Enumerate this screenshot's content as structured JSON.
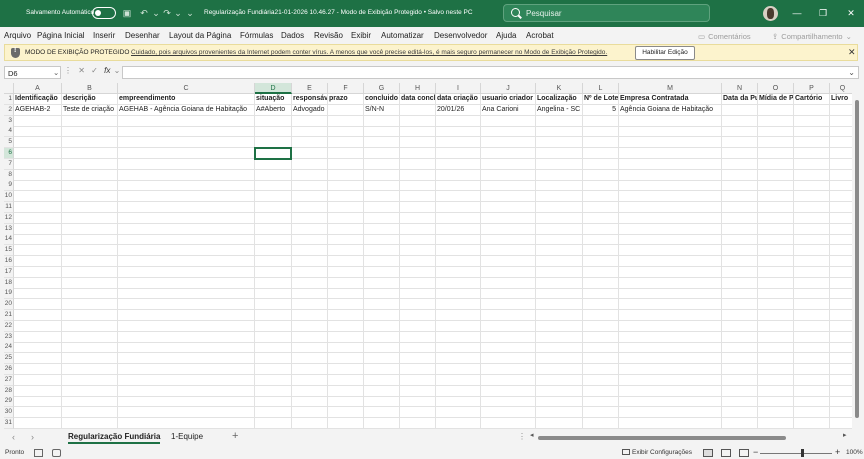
{
  "titlebar": {
    "autosave_label": "Salvamento Automático",
    "document_title": "Regularização Fundiária21-01-2026 10.46.27  -  Modo de Exibição Protegido  •  Salvo neste PC",
    "search_placeholder": "Pesquisar",
    "accent_color": "#1e7145"
  },
  "menu": {
    "items": [
      "Arquivo",
      "Página Inicial",
      "Inserir",
      "Desenhar",
      "Layout da Página",
      "Fórmulas",
      "Dados",
      "Revisão",
      "Exibir",
      "Automatizar",
      "Desenvolvedor",
      "Ajuda",
      "Acrobat"
    ],
    "comments": "Comentários",
    "share": "Compartilhamento"
  },
  "banner": {
    "title": "MODO DE EXIBIÇÃO PROTEGIDO",
    "message": "Cuidado, pois arquivos provenientes da Internet podem conter vírus. A menos que você precise editá-los, é mais seguro permanecer no Modo de  Exibição Protegido.",
    "enable_button": "Habilitar Edição"
  },
  "formula_bar": {
    "name_box": "D6",
    "fx": "fx",
    "value": ""
  },
  "sheet": {
    "columns": [
      "A",
      "B",
      "C",
      "D",
      "E",
      "F",
      "G",
      "H",
      "I",
      "J",
      "K",
      "L",
      "M",
      "N",
      "O",
      "P",
      "Q"
    ],
    "selected_column": "D",
    "selected_row": 6,
    "rows": [
      [
        "Identificação",
        "descrição",
        "empreendimento",
        "situação",
        "responsável",
        "prazo",
        "concluido",
        "data conclusão",
        "data criação",
        "usuario criador",
        "Localização",
        "Nº de Lotes",
        "Empresa Contratada",
        "Data da Publicação",
        "Mídia de Publicação",
        "Cartório",
        "Livro"
      ],
      [
        "AGEHAB-2",
        "Teste de criação",
        "AGEHAB - Agência Goiana de Habitação",
        "A#Aberto",
        "Advogado",
        "",
        "S/N-N",
        "",
        "20/01/26",
        "Ana Carioni",
        "Angelina - SC",
        "5",
        "Agência Goiana de Habitação",
        "",
        "",
        "",
        ""
      ]
    ],
    "row_count": 31
  },
  "tabs": {
    "sheets": [
      "Regularização Fundiária",
      "1-Equipe"
    ],
    "active": "Regularização Fundiária"
  },
  "status": {
    "ready": "Pronto",
    "display_settings": "Exibir Configurações",
    "zoom": "100%"
  }
}
